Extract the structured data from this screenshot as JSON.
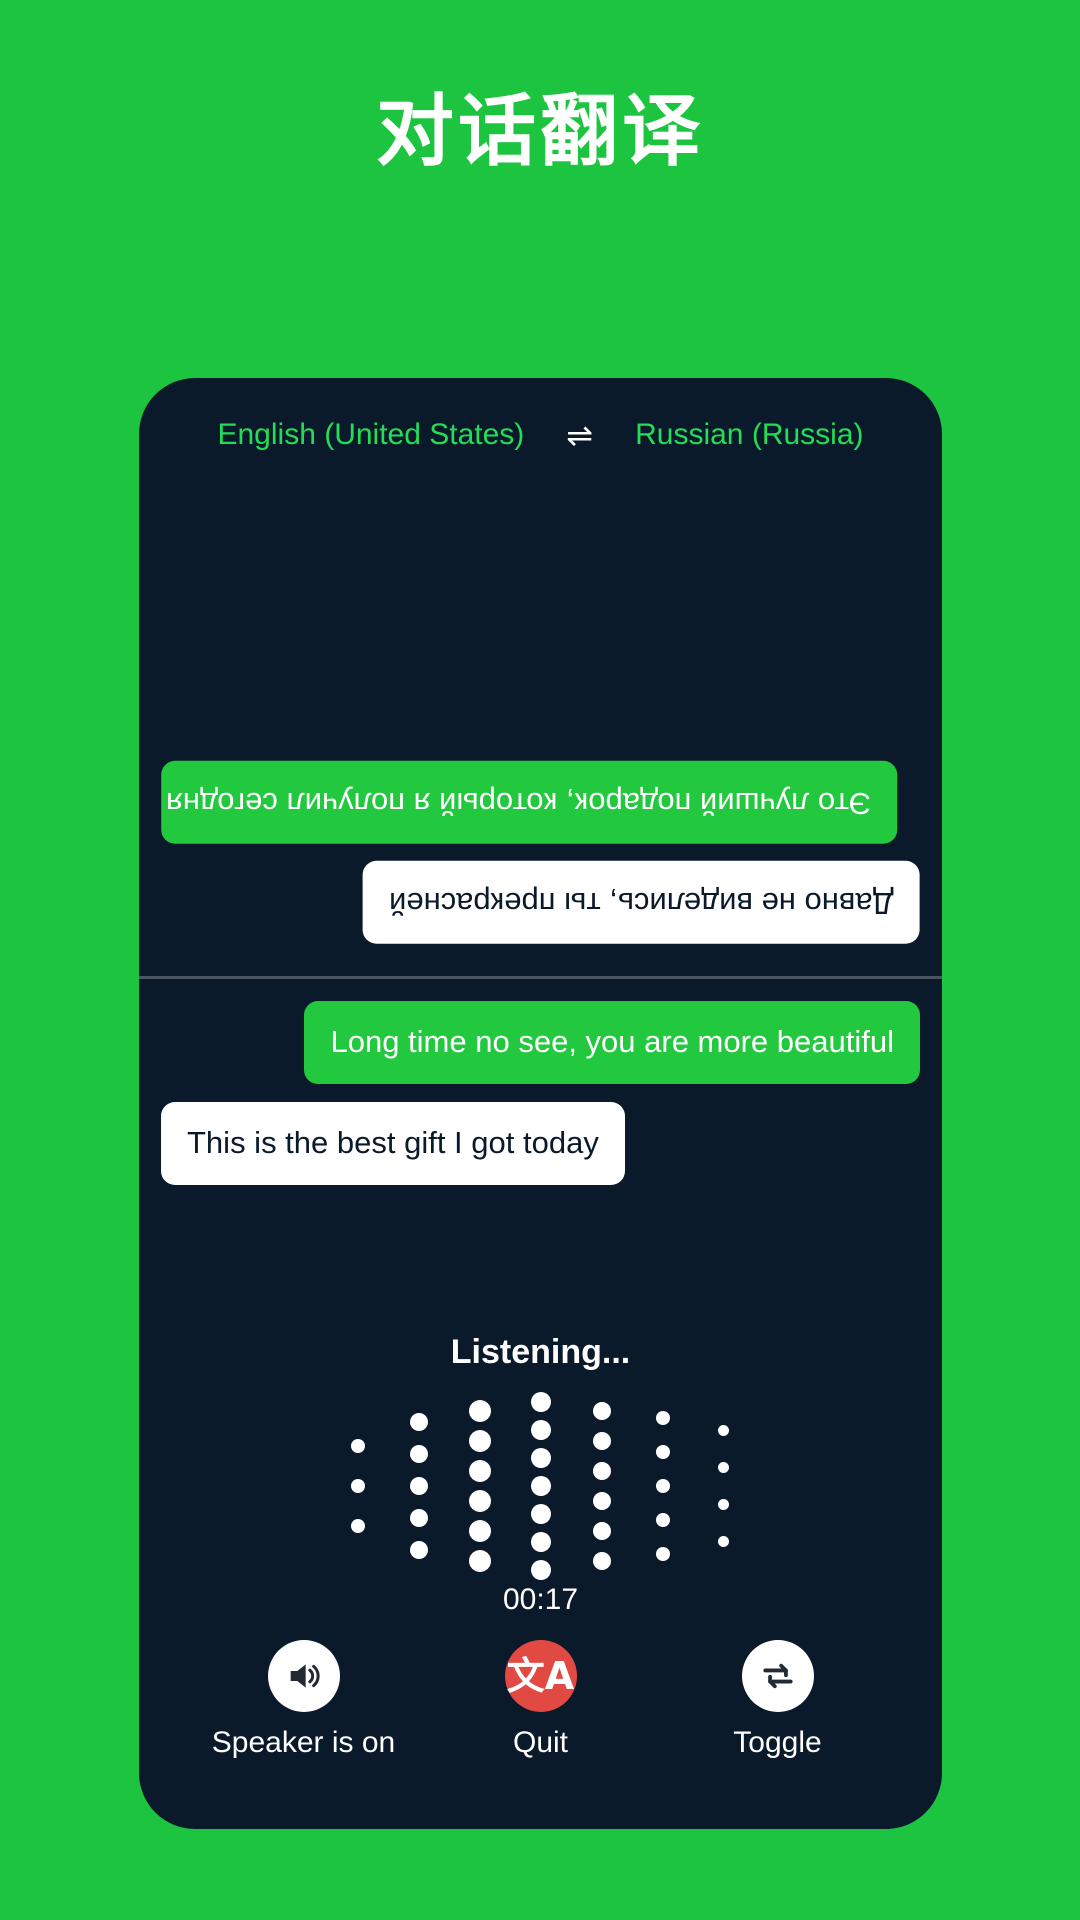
{
  "page": {
    "title": "对话翻译",
    "background_color": "#1cc43f",
    "panel_color": "#0b1a2b"
  },
  "language_bar": {
    "source_language": "English (United States)",
    "swap_icon": "swap-horizontal-icon",
    "swap_glyph": "⇌",
    "target_language": "Russian (Russia)",
    "text_color": "#22dd55"
  },
  "conversation": {
    "remote_panel": {
      "messages": [
        {
          "text": "Это лучший подарок, который я получил сегодня",
          "style": "green",
          "align": "left",
          "rotated": true
        },
        {
          "text": "Давно не виделись, ты прекрасней",
          "style": "white",
          "align": "right",
          "rotated": true
        }
      ]
    },
    "local_panel": {
      "messages": [
        {
          "text": "Long time no see, you are more beautiful",
          "style": "green",
          "align": "right",
          "rotated": false
        },
        {
          "text": "This is the best gift I got today",
          "style": "white",
          "align": "left",
          "rotated": false
        }
      ]
    }
  },
  "status": {
    "listening_label": "Listening...",
    "timer": "00:17"
  },
  "waveform": {
    "dot_color": "#ffffff",
    "columns": [
      {
        "count": 3,
        "size": 14,
        "gap": 26
      },
      {
        "count": 5,
        "size": 18,
        "gap": 14
      },
      {
        "count": 6,
        "size": 22,
        "gap": 8
      },
      {
        "count": 7,
        "size": 20,
        "gap": 8
      },
      {
        "count": 6,
        "size": 18,
        "gap": 12
      },
      {
        "count": 5,
        "size": 14,
        "gap": 20
      },
      {
        "count": 4,
        "size": 11,
        "gap": 26
      }
    ]
  },
  "controls": [
    {
      "label": "Speaker is on",
      "icon": "speaker-on-icon",
      "circle_color": "#ffffff",
      "name": "speaker-button"
    },
    {
      "label": "Quit",
      "icon": "translate-icon",
      "glyph": "文A",
      "circle_color": "#e04a43",
      "name": "quit-button"
    },
    {
      "label": "Toggle",
      "icon": "toggle-swap-icon",
      "circle_color": "#ffffff",
      "name": "toggle-button"
    }
  ]
}
